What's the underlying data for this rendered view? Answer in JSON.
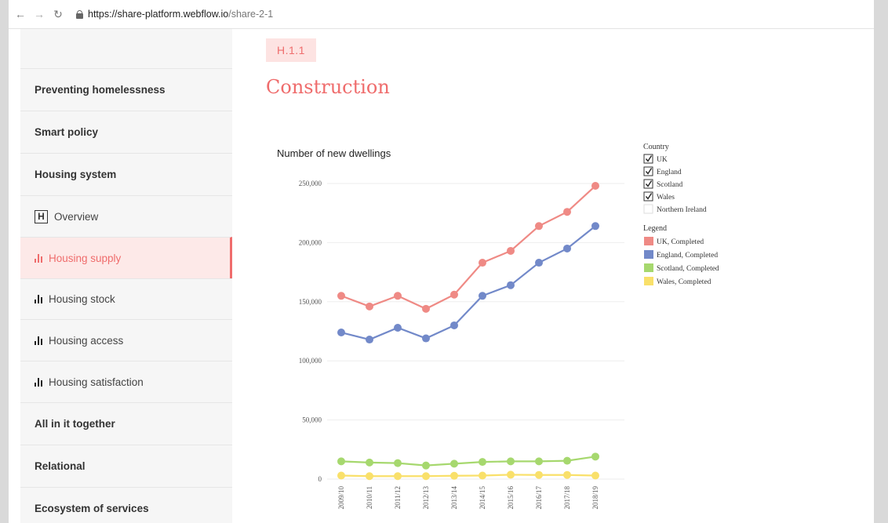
{
  "browser": {
    "url_host": "https://share-platform.webflow.io",
    "url_path": "/share-2-1"
  },
  "sidebar": {
    "items": [
      {
        "label": "Preventing homelessness",
        "kind": "section"
      },
      {
        "label": "Smart policy",
        "kind": "section"
      },
      {
        "label": "Housing system",
        "kind": "section"
      },
      {
        "label": "Overview",
        "kind": "sub",
        "icon": "h-square-icon"
      },
      {
        "label": "Housing supply",
        "kind": "sub",
        "icon": "bar-chart-icon",
        "active": true
      },
      {
        "label": "Housing stock",
        "kind": "sub",
        "icon": "bar-chart-icon"
      },
      {
        "label": "Housing access",
        "kind": "sub",
        "icon": "bar-chart-icon"
      },
      {
        "label": "Housing satisfaction",
        "kind": "sub",
        "icon": "bar-chart-icon"
      },
      {
        "label": "All in it together",
        "kind": "section"
      },
      {
        "label": "Relational",
        "kind": "section"
      },
      {
        "label": "Ecosystem of services",
        "kind": "section"
      }
    ]
  },
  "main": {
    "badge": "H.1.1",
    "title": "Construction"
  },
  "filters": {
    "heading": "Country",
    "options": [
      {
        "label": "UK",
        "checked": true
      },
      {
        "label": "England",
        "checked": true
      },
      {
        "label": "Scotland",
        "checked": true
      },
      {
        "label": "Wales",
        "checked": true
      },
      {
        "label": "Northern Ireland",
        "checked": false
      }
    ]
  },
  "legend": {
    "heading": "Legend"
  },
  "chart_data": {
    "type": "line",
    "title": "Number of new dwellings",
    "xlabel": "",
    "ylabel": "",
    "x": [
      "2009/10",
      "2010/11",
      "2011/12",
      "2012/13",
      "2013/14",
      "2014/15",
      "2015/16",
      "2016/17",
      "2017/18",
      "2018/19"
    ],
    "ylim": [
      0,
      250000
    ],
    "yticks": [
      0,
      50000,
      100000,
      150000,
      200000,
      250000
    ],
    "ytick_labels": [
      "0",
      "50,000",
      "100,000",
      "150,000",
      "200,000",
      "250,000"
    ],
    "grid": true,
    "legend_position": "right",
    "series": [
      {
        "name": "UK, Completed",
        "color": "#ef8a85",
        "values": [
          155000,
          146000,
          155000,
          144000,
          156000,
          183000,
          193000,
          214000,
          226000,
          248000
        ]
      },
      {
        "name": "England, Completed",
        "color": "#7289c9",
        "values": [
          124000,
          118000,
          128000,
          119000,
          130000,
          155000,
          164000,
          183000,
          195000,
          214000
        ]
      },
      {
        "name": "Scotland, Completed",
        "color": "#a6d86e",
        "values": [
          15000,
          14000,
          13500,
          11500,
          13000,
          14500,
          15000,
          15000,
          15500,
          19000
        ]
      },
      {
        "name": "Wales, Completed",
        "color": "#f9e06a",
        "values": [
          3000,
          2500,
          2500,
          2500,
          2800,
          3000,
          3700,
          3500,
          3500,
          3000
        ]
      }
    ]
  }
}
